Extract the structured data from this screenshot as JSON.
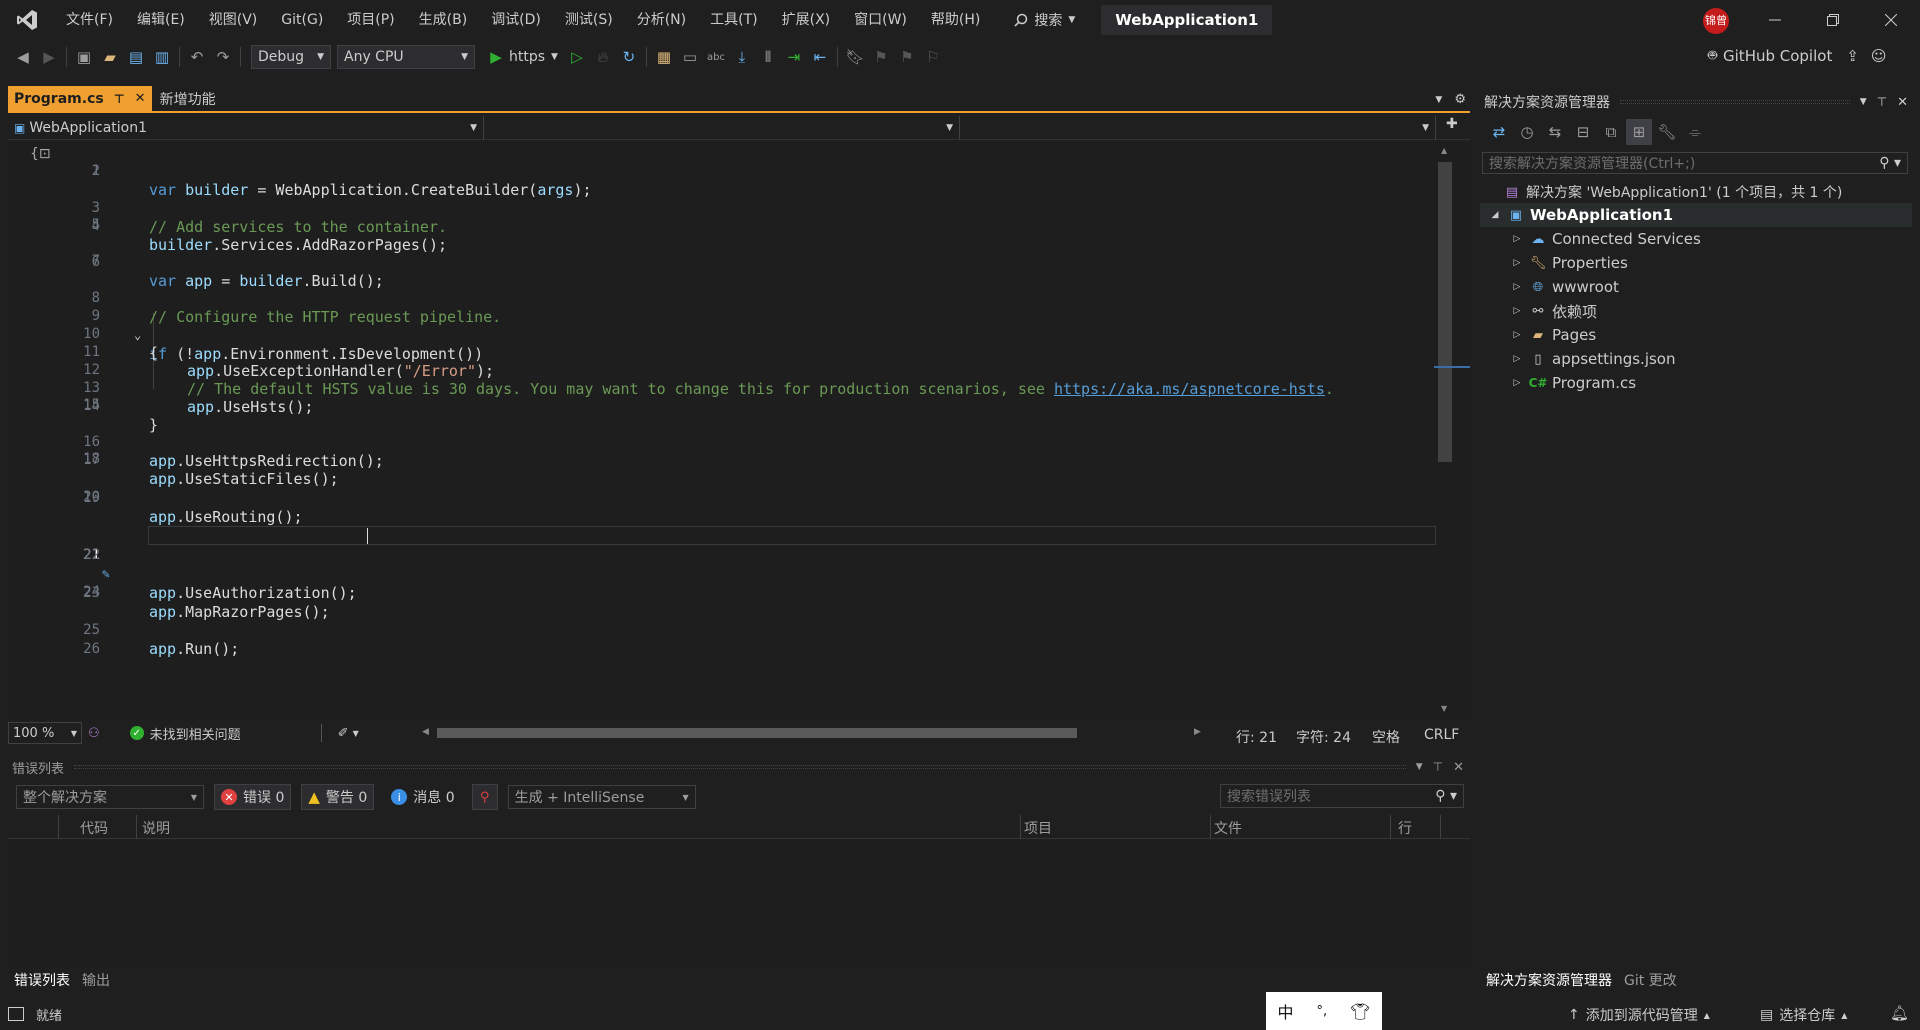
{
  "menu": {
    "items": [
      "文件(F)",
      "编辑(E)",
      "视图(V)",
      "Git(G)",
      "项目(P)",
      "生成(B)",
      "调试(D)",
      "测试(S)",
      "分析(N)",
      "工具(T)",
      "扩展(X)",
      "窗口(W)",
      "帮助(H)"
    ],
    "search_label": "搜索",
    "solution_title": "WebApplication1",
    "avatar_text": "锦曾"
  },
  "toolbar": {
    "config": "Debug",
    "platform": "Any CPU",
    "run_profile": "https",
    "copilot": "GitHub Copilot"
  },
  "editor": {
    "active_tab": "Program.cs",
    "other_tab": "新增功能",
    "nav_project": "WebApplication1",
    "current_line": 21,
    "line_count": 26,
    "zoom": "100 %",
    "issues": "未找到相关问题",
    "position": {
      "line": "行: 21",
      "char": "字符: 24",
      "spaces": "空格",
      "eol": "CRLF"
    }
  },
  "code": {
    "l1": {
      "kw": "var",
      "id": "builder",
      "rest": " = WebApplication.CreateBuilder(",
      "arg": "args",
      "end": ");"
    },
    "l3": "// Add services to the container.",
    "l4": {
      "id": "builder",
      "rest": ".Services.AddRazorPages();"
    },
    "l6": {
      "kw": "var",
      "id": "app",
      "mid": " = ",
      "id2": "builder",
      "rest": ".Build();"
    },
    "l8": "// Configure the HTTP request pipeline.",
    "l9": {
      "kw": "if",
      "open": " (!",
      "id": "app",
      "rest": ".Environment.IsDevelopment())"
    },
    "l10": "{",
    "l11": {
      "id": "app",
      "rest": ".UseExceptionHandler(",
      "str": "\"/Error\"",
      "end": ");"
    },
    "l12": {
      "comment": "// The default HSTS value is 30 days. You may want to change this for production scenarios, see ",
      "link": "https://aka.ms/aspnetcore-hsts",
      "end": "."
    },
    "l13": {
      "id": "app",
      "rest": ".UseHsts();"
    },
    "l14": "}",
    "l16": {
      "id": "app",
      "rest": ".UseHttpsRedirection();"
    },
    "l17": {
      "id": "app",
      "rest": ".UseStaticFiles();"
    },
    "l19": {
      "id": "app",
      "rest": ".UseRouting();"
    },
    "l21": {
      "id": "app",
      "rest": ".UseAuthorization();"
    },
    "l23": {
      "id": "app",
      "rest": ".MapRazorPages();"
    },
    "l25": {
      "id": "app",
      "rest": ".Run();"
    }
  },
  "error_list": {
    "title": "错误列表",
    "scope": "整个解决方案",
    "errors": "错误 0",
    "warnings": "警告 0",
    "messages": "消息 0",
    "source": "生成 + IntelliSense",
    "search_placeholder": "搜索错误列表",
    "columns": {
      "code": "代码",
      "desc": "说明",
      "project": "项目",
      "file": "文件",
      "line": "行"
    },
    "tab_errors": "错误列表",
    "tab_output": "输出"
  },
  "solution_explorer": {
    "title": "解决方案资源管理器",
    "search_placeholder": "搜索解决方案资源管理器(Ctrl+;)",
    "solution": "解决方案 'WebApplication1' (1 个项目，共 1 个)",
    "project": "WebApplication1",
    "items": [
      "Connected Services",
      "Properties",
      "wwwroot",
      "依赖项",
      "Pages",
      "appsettings.json",
      "Program.cs"
    ],
    "tab_explorer": "解决方案资源管理器",
    "tab_git": "Git 更改"
  },
  "statusbar": {
    "ready": "就绪",
    "add_source": "添加到源代码管理",
    "select_repo": "选择仓库",
    "ime_lang": "中"
  },
  "colors": {
    "accent_tab": "#f0a030",
    "keyword": "#569cd6",
    "identifier": "#9cdcfe",
    "string": "#d69d85",
    "comment": "#6a9955",
    "error_red": "#e04040",
    "warning_yellow": "#f0c020",
    "info_blue": "#3a8ee6"
  }
}
